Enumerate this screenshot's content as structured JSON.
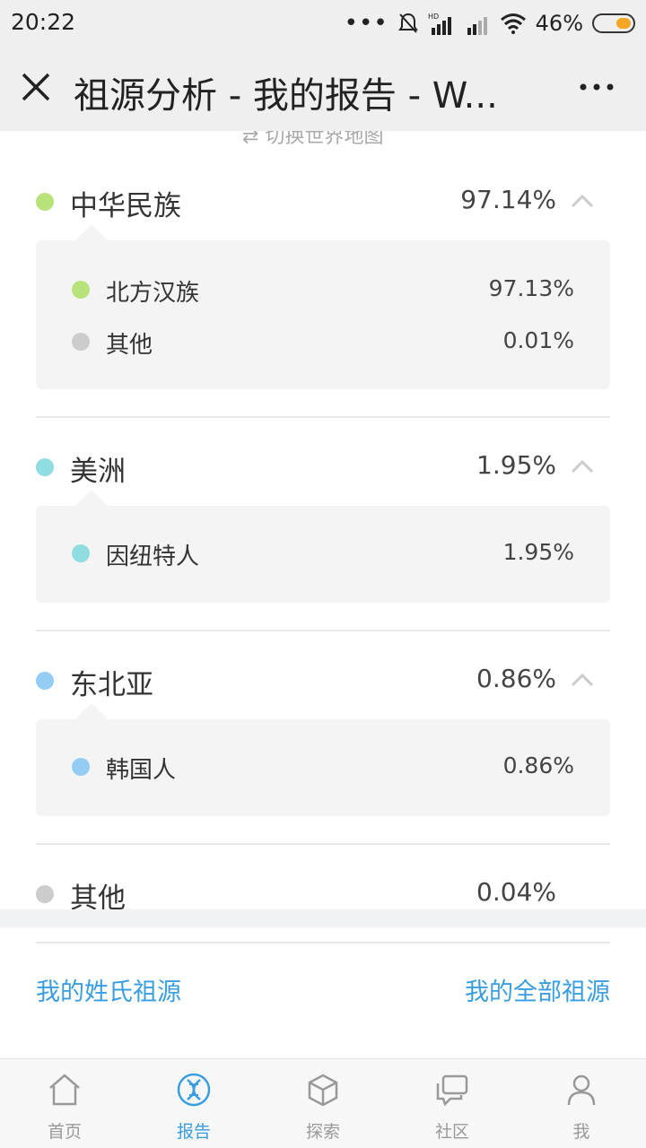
{
  "status_bar": {
    "time": "20:22",
    "battery": "46%",
    "icons": [
      "dots-icon",
      "mute-bell-icon",
      "hd-signal-icon",
      "signal-icon",
      "wifi-icon",
      "battery-icon"
    ]
  },
  "title_bar": {
    "title": "祖源分析 - 我的报告 - W...",
    "close_icon": "close-icon",
    "more_icon": "more-icon"
  },
  "switch_map": "切换世界地图",
  "groups": [
    {
      "name": "中华民族",
      "pct": "97.14%",
      "color": "#b8e27a",
      "subs": [
        {
          "name": "北方汉族",
          "pct": "97.13%",
          "color": "#b8e27a"
        },
        {
          "name": "其他",
          "pct": "0.01%",
          "color": "#cccccc"
        }
      ]
    },
    {
      "name": "美洲",
      "pct": "1.95%",
      "color": "#8fdde0",
      "subs": [
        {
          "name": "因纽特人",
          "pct": "1.95%",
          "color": "#8fdde0"
        }
      ]
    },
    {
      "name": "东北亚",
      "pct": "0.86%",
      "color": "#94cdf3",
      "subs": [
        {
          "name": "韩国人",
          "pct": "0.86%",
          "color": "#94cdf3"
        }
      ]
    },
    {
      "name": "其他",
      "pct": "0.04%",
      "color": "#cccccc",
      "subs": []
    }
  ],
  "links": {
    "surname": "我的姓氏祖源",
    "all": "我的全部祖源"
  },
  "bottom_nav": [
    {
      "label": "首页",
      "icon": "home-icon",
      "active": false
    },
    {
      "label": "报告",
      "icon": "dna-icon",
      "active": true
    },
    {
      "label": "探索",
      "icon": "cube-icon",
      "active": false
    },
    {
      "label": "社区",
      "icon": "chat-icon",
      "active": false
    },
    {
      "label": "我",
      "icon": "person-icon",
      "active": false
    }
  ],
  "colors": {
    "accent": "#3a9de0",
    "battery": "#f5a623"
  }
}
